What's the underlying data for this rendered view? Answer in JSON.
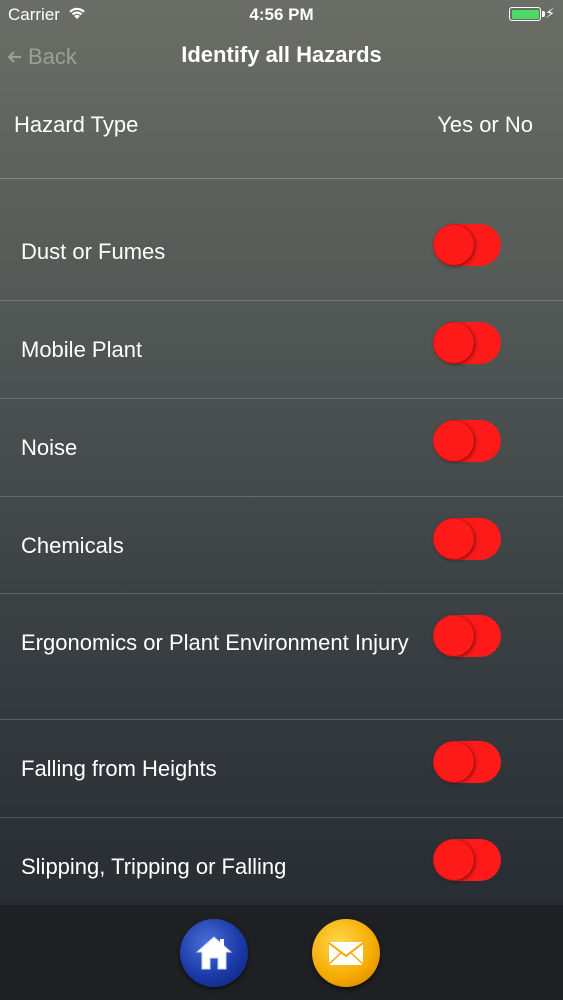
{
  "status_bar": {
    "carrier": "Carrier",
    "time": "4:56 PM",
    "battery_color": "#4cd964"
  },
  "nav": {
    "back_label": "Back",
    "title": "Identify all Hazards"
  },
  "header": {
    "hazard_type": "Hazard Type",
    "yes_or_no": "Yes or No"
  },
  "hazards": [
    {
      "label": "Dust or Fumes"
    },
    {
      "label": "Mobile Plant"
    },
    {
      "label": "Noise"
    },
    {
      "label": "Chemicals"
    },
    {
      "label": "Ergonomics or Plant Environment Injury"
    },
    {
      "label": "Falling from Heights"
    },
    {
      "label": "Slipping, Tripping or Falling"
    }
  ],
  "toggle_color": "#ff1a1a",
  "bottom_bar": {
    "home_icon": "home-icon",
    "mail_icon": "mail-icon"
  }
}
